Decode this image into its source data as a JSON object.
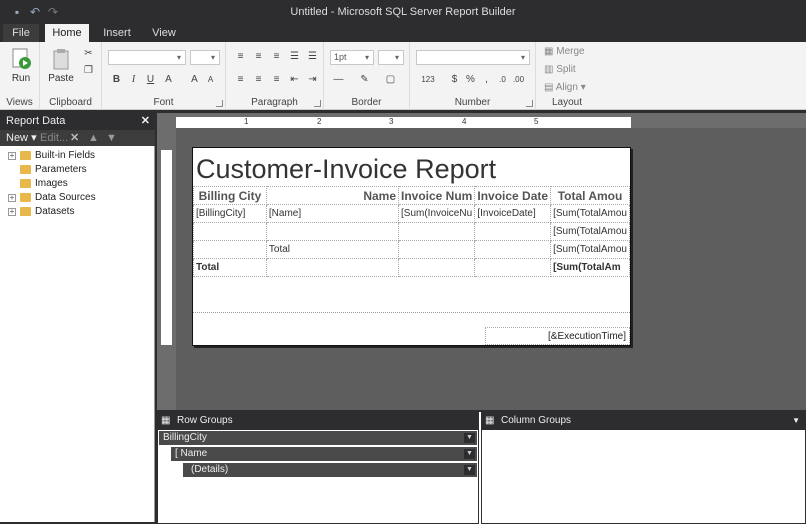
{
  "window": {
    "title": "Untitled - Microsoft SQL Server Report Builder"
  },
  "tabs": [
    {
      "label": "File"
    },
    {
      "label": "Home"
    },
    {
      "label": "Insert"
    },
    {
      "label": "View"
    }
  ],
  "ribbon": {
    "views": {
      "label": "Views",
      "run": "Run"
    },
    "clipboard": {
      "label": "Clipboard",
      "paste": "Paste"
    },
    "font": {
      "label": "Font",
      "bold": "B",
      "italic": "I",
      "underline": "U"
    },
    "paragraph": {
      "label": "Paragraph"
    },
    "border": {
      "label": "Border",
      "size": "1pt"
    },
    "number": {
      "label": "Number",
      "currency": "$",
      "percent": "%"
    },
    "layout": {
      "label": "Layout",
      "merge": "Merge",
      "split": "Split",
      "align": "Align"
    }
  },
  "report_data": {
    "title": "Report Data",
    "new_label": "New",
    "edit_label": "Edit...",
    "items": [
      {
        "label": "Built-in Fields"
      },
      {
        "label": "Parameters"
      },
      {
        "label": "Images"
      },
      {
        "label": "Data Sources"
      },
      {
        "label": "Datasets"
      }
    ]
  },
  "ruler": {
    "marks": [
      "1",
      "2",
      "3",
      "4",
      "5"
    ]
  },
  "report": {
    "title": "Customer-Invoice Report",
    "headers": [
      "Billing City",
      "Name",
      "Invoice Num",
      "Invoice Date",
      "Total Amou"
    ],
    "rows": [
      [
        "[BillingCity]",
        "[Name]",
        "[Sum(InvoiceNu",
        "[InvoiceDate]",
        "[Sum(TotalAmou"
      ],
      [
        "",
        "",
        "",
        "",
        "[Sum(TotalAmou"
      ],
      [
        "",
        "Total",
        "",
        "",
        "[Sum(TotalAmou"
      ],
      [
        "Total",
        "",
        "",
        "",
        "[Sum(TotalAm"
      ]
    ],
    "execution_time": "[&ExecutionTime]"
  },
  "row_groups": {
    "title": "Row Groups",
    "items": [
      {
        "label": "BillingCity"
      },
      {
        "label": "[ Name"
      },
      {
        "label": "(Details)"
      }
    ]
  },
  "column_groups": {
    "title": "Column Groups"
  }
}
